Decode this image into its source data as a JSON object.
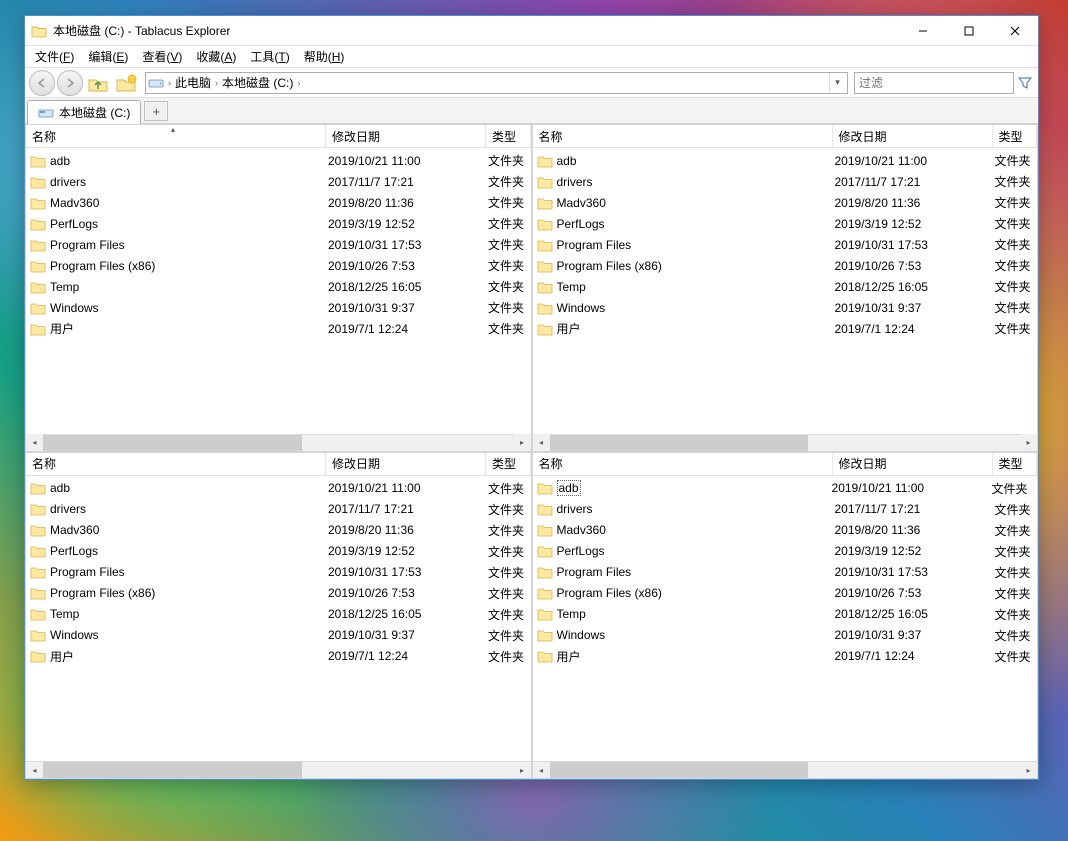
{
  "window": {
    "title": "本地磁盘 (C:) - Tablacus Explorer"
  },
  "menu": {
    "file": "文件(F)",
    "edit": "编辑(E)",
    "view": "查看(V)",
    "favorites": "收藏(A)",
    "tools": "工具(T)",
    "help": "帮助(H)"
  },
  "address": {
    "root": "此电脑",
    "drive": "本地磁盘 (C:)"
  },
  "filter": {
    "placeholder": "过滤"
  },
  "tab": {
    "label": "本地磁盘 (C:)"
  },
  "columns": {
    "name": "名称",
    "date": "修改日期",
    "type": "类型"
  },
  "folders": [
    {
      "name": "adb",
      "date": "2019/10/21 11:00",
      "type": "文件夹"
    },
    {
      "name": "drivers",
      "date": "2017/11/7 17:21",
      "type": "文件夹"
    },
    {
      "name": "Madv360",
      "date": "2019/8/20 11:36",
      "type": "文件夹"
    },
    {
      "name": "PerfLogs",
      "date": "2019/3/19 12:52",
      "type": "文件夹"
    },
    {
      "name": "Program Files",
      "date": "2019/10/31 17:53",
      "type": "文件夹"
    },
    {
      "name": "Program Files (x86)",
      "date": "2019/10/26 7:53",
      "type": "文件夹"
    },
    {
      "name": "Temp",
      "date": "2018/12/25 16:05",
      "type": "文件夹"
    },
    {
      "name": "Windows",
      "date": "2019/10/31 9:37",
      "type": "文件夹"
    },
    {
      "name": "用户",
      "date": "2019/7/1 12:24",
      "type": "文件夹"
    }
  ]
}
